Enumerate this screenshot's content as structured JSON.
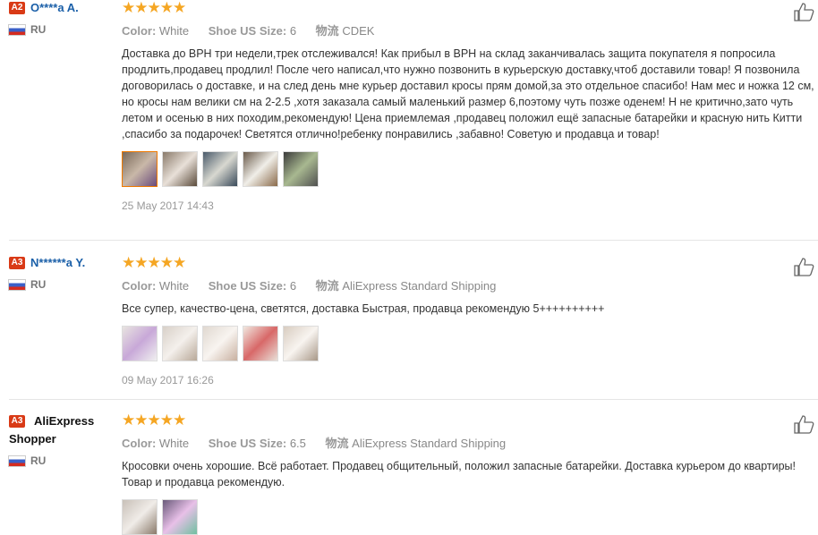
{
  "labels": {
    "color": "Color:",
    "size": "Shoe US Size:",
    "ship": "物流"
  },
  "reviews": [
    {
      "badge": "A2",
      "name": "O****a A.",
      "country": "RU",
      "stars": "★★★★★",
      "color": "White",
      "size": "6",
      "ship": "CDEK",
      "text": "Доставка до ВРН три недели,трек отслеживался! Как прибыл в ВРН на склад заканчивалась защита покупателя я попросила продлить,продавец продлил! После чего написал,что нужно позвонить в курьерскую доставку,чтоб доставили товар! Я позвонила договорилась о доставке, и на след день мне курьер доставил кросы прям домой,за это отдельное спасибо! Нам мес и ножка 12 см, но кросы нам велики см на 2-2.5 ,хотя заказала самый маленький размер 6,поэтому чуть позже оденем! Н не критично,зато чуть летом и осенью в них походим,рекомендую! Цена приемлемая ,продавец положил ещё запасные батарейки и красную нить Китти ,спасибо за подарочек! Светятся отлично!ребенку понравились ,забавно! Советую и продавца и товар!",
      "date": "25 May 2017 14:43"
    },
    {
      "badge": "A3",
      "name": "N******a Y.",
      "country": "RU",
      "stars": "★★★★★",
      "color": "White",
      "size": "6",
      "ship": "AliExpress Standard Shipping",
      "text": "Все супер, качество-цена, светятся, доставка Быстрая, продавца рекомендую 5++++++++++",
      "date": "09 May 2017 16:26"
    },
    {
      "badge": "A3",
      "name": "AliExpress Shopper",
      "country": "RU",
      "stars": "★★★★★",
      "color": "White",
      "size": "6.5",
      "ship": "AliExpress Standard Shipping",
      "text": "Кросовки очень хорошие. Всё работает. Продавец общительный, положил запасные батарейки. Доставка курьером до квартиры! Товар и продавца рекомендую."
    }
  ],
  "colors": {
    "badge": "#d93a16",
    "star": "#f5a623",
    "name": "#1a5fa8"
  }
}
